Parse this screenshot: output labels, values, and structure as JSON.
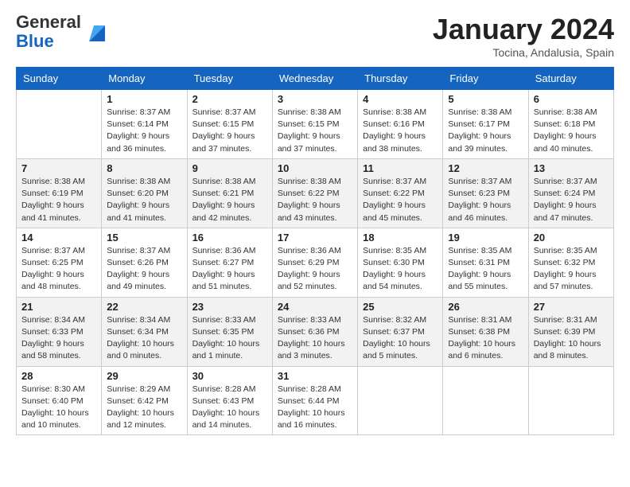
{
  "header": {
    "logo_general": "General",
    "logo_blue": "Blue",
    "title": "January 2024",
    "subtitle": "Tocina, Andalusia, Spain"
  },
  "columns": [
    "Sunday",
    "Monday",
    "Tuesday",
    "Wednesday",
    "Thursday",
    "Friday",
    "Saturday"
  ],
  "weeks": [
    [
      {
        "num": "",
        "info": ""
      },
      {
        "num": "1",
        "info": "Sunrise: 8:37 AM\nSunset: 6:14 PM\nDaylight: 9 hours\nand 36 minutes."
      },
      {
        "num": "2",
        "info": "Sunrise: 8:37 AM\nSunset: 6:15 PM\nDaylight: 9 hours\nand 37 minutes."
      },
      {
        "num": "3",
        "info": "Sunrise: 8:38 AM\nSunset: 6:15 PM\nDaylight: 9 hours\nand 37 minutes."
      },
      {
        "num": "4",
        "info": "Sunrise: 8:38 AM\nSunset: 6:16 PM\nDaylight: 9 hours\nand 38 minutes."
      },
      {
        "num": "5",
        "info": "Sunrise: 8:38 AM\nSunset: 6:17 PM\nDaylight: 9 hours\nand 39 minutes."
      },
      {
        "num": "6",
        "info": "Sunrise: 8:38 AM\nSunset: 6:18 PM\nDaylight: 9 hours\nand 40 minutes."
      }
    ],
    [
      {
        "num": "7",
        "info": "Sunrise: 8:38 AM\nSunset: 6:19 PM\nDaylight: 9 hours\nand 41 minutes."
      },
      {
        "num": "8",
        "info": "Sunrise: 8:38 AM\nSunset: 6:20 PM\nDaylight: 9 hours\nand 41 minutes."
      },
      {
        "num": "9",
        "info": "Sunrise: 8:38 AM\nSunset: 6:21 PM\nDaylight: 9 hours\nand 42 minutes."
      },
      {
        "num": "10",
        "info": "Sunrise: 8:38 AM\nSunset: 6:22 PM\nDaylight: 9 hours\nand 43 minutes."
      },
      {
        "num": "11",
        "info": "Sunrise: 8:37 AM\nSunset: 6:22 PM\nDaylight: 9 hours\nand 45 minutes."
      },
      {
        "num": "12",
        "info": "Sunrise: 8:37 AM\nSunset: 6:23 PM\nDaylight: 9 hours\nand 46 minutes."
      },
      {
        "num": "13",
        "info": "Sunrise: 8:37 AM\nSunset: 6:24 PM\nDaylight: 9 hours\nand 47 minutes."
      }
    ],
    [
      {
        "num": "14",
        "info": "Sunrise: 8:37 AM\nSunset: 6:25 PM\nDaylight: 9 hours\nand 48 minutes."
      },
      {
        "num": "15",
        "info": "Sunrise: 8:37 AM\nSunset: 6:26 PM\nDaylight: 9 hours\nand 49 minutes."
      },
      {
        "num": "16",
        "info": "Sunrise: 8:36 AM\nSunset: 6:27 PM\nDaylight: 9 hours\nand 51 minutes."
      },
      {
        "num": "17",
        "info": "Sunrise: 8:36 AM\nSunset: 6:29 PM\nDaylight: 9 hours\nand 52 minutes."
      },
      {
        "num": "18",
        "info": "Sunrise: 8:35 AM\nSunset: 6:30 PM\nDaylight: 9 hours\nand 54 minutes."
      },
      {
        "num": "19",
        "info": "Sunrise: 8:35 AM\nSunset: 6:31 PM\nDaylight: 9 hours\nand 55 minutes."
      },
      {
        "num": "20",
        "info": "Sunrise: 8:35 AM\nSunset: 6:32 PM\nDaylight: 9 hours\nand 57 minutes."
      }
    ],
    [
      {
        "num": "21",
        "info": "Sunrise: 8:34 AM\nSunset: 6:33 PM\nDaylight: 9 hours\nand 58 minutes."
      },
      {
        "num": "22",
        "info": "Sunrise: 8:34 AM\nSunset: 6:34 PM\nDaylight: 10 hours\nand 0 minutes."
      },
      {
        "num": "23",
        "info": "Sunrise: 8:33 AM\nSunset: 6:35 PM\nDaylight: 10 hours\nand 1 minute."
      },
      {
        "num": "24",
        "info": "Sunrise: 8:33 AM\nSunset: 6:36 PM\nDaylight: 10 hours\nand 3 minutes."
      },
      {
        "num": "25",
        "info": "Sunrise: 8:32 AM\nSunset: 6:37 PM\nDaylight: 10 hours\nand 5 minutes."
      },
      {
        "num": "26",
        "info": "Sunrise: 8:31 AM\nSunset: 6:38 PM\nDaylight: 10 hours\nand 6 minutes."
      },
      {
        "num": "27",
        "info": "Sunrise: 8:31 AM\nSunset: 6:39 PM\nDaylight: 10 hours\nand 8 minutes."
      }
    ],
    [
      {
        "num": "28",
        "info": "Sunrise: 8:30 AM\nSunset: 6:40 PM\nDaylight: 10 hours\nand 10 minutes."
      },
      {
        "num": "29",
        "info": "Sunrise: 8:29 AM\nSunset: 6:42 PM\nDaylight: 10 hours\nand 12 minutes."
      },
      {
        "num": "30",
        "info": "Sunrise: 8:28 AM\nSunset: 6:43 PM\nDaylight: 10 hours\nand 14 minutes."
      },
      {
        "num": "31",
        "info": "Sunrise: 8:28 AM\nSunset: 6:44 PM\nDaylight: 10 hours\nand 16 minutes."
      },
      {
        "num": "",
        "info": ""
      },
      {
        "num": "",
        "info": ""
      },
      {
        "num": "",
        "info": ""
      }
    ]
  ]
}
